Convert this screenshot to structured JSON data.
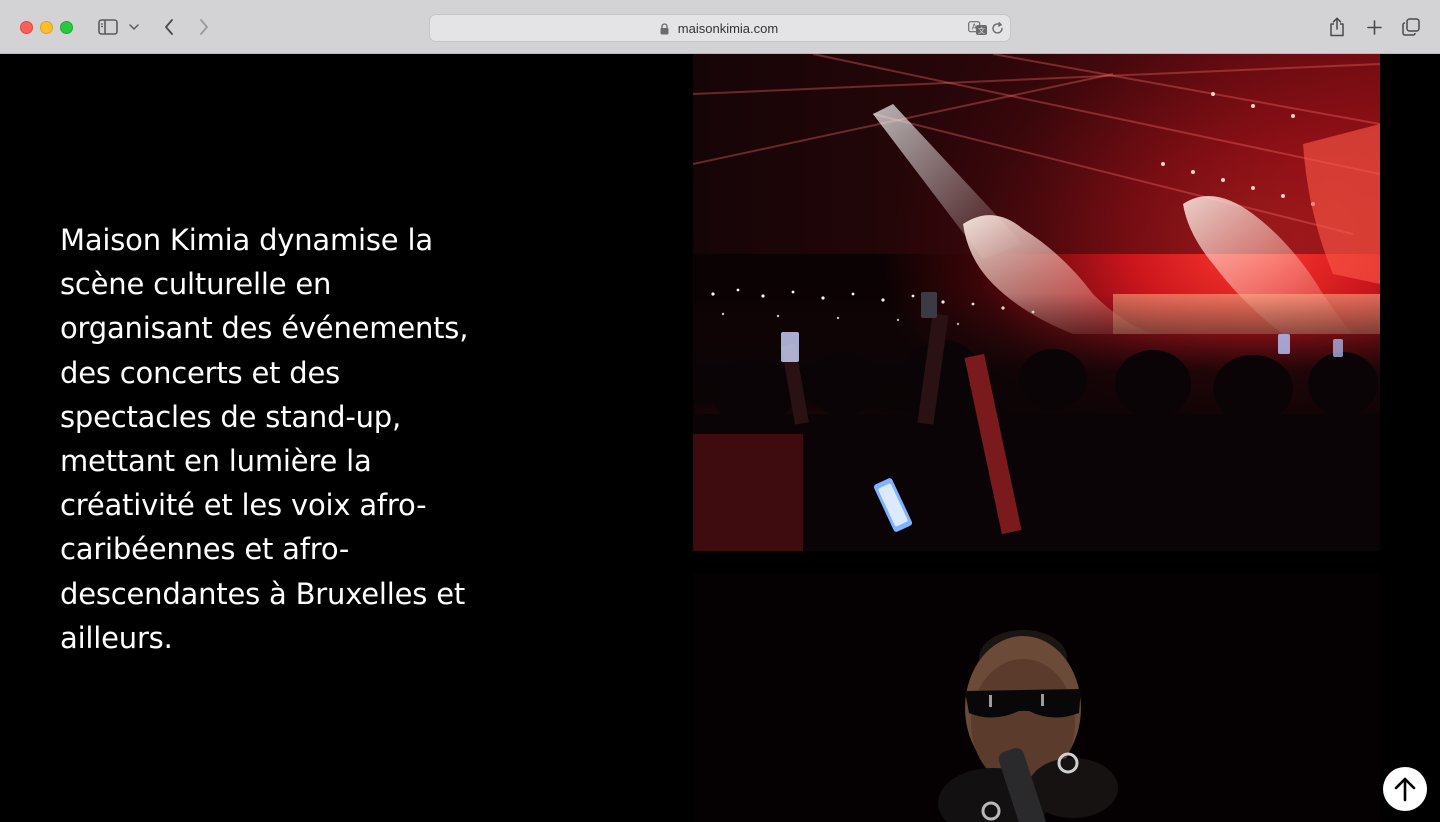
{
  "browser": {
    "url": "maisonkimia.com",
    "icons": {
      "sidebar": "sidebar-icon",
      "caret": "chevron-down-icon",
      "back": "chevron-left-icon",
      "forward": "chevron-right-icon",
      "lock": "lock-icon",
      "translate": "translate-icon",
      "reload": "reload-icon",
      "share": "share-icon",
      "new_tab": "plus-icon",
      "tabs": "tabs-overview-icon"
    }
  },
  "main": {
    "intro_text": "Maison Kimia dynamise la scène culturelle en organisant des événements, des concerts et des spectacles de stand-up, mettant en lumière la créativité et les voix afro-caribéennes et afro-descendantes à Bruxelles et ailleurs.",
    "text_color": "#ffffff",
    "background": "#000000"
  },
  "scroll_top": {
    "icon": "arrow-up-icon"
  }
}
